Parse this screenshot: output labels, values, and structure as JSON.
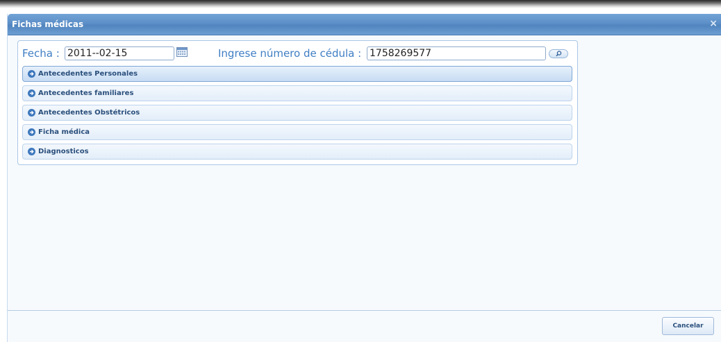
{
  "dialog": {
    "title": "Fichas médicas",
    "close_icon": "close-icon",
    "close_glyph": "×"
  },
  "form": {
    "fecha_label": "Fecha :",
    "fecha_value": "2011--02-15",
    "calendar_icon": "calendar-icon",
    "cedula_label": "Ingrese número de cédula :",
    "cedula_value": "1758269577",
    "search_icon": "search-icon"
  },
  "accordion": {
    "items": [
      {
        "label": "Antecedentes Personales",
        "active": true
      },
      {
        "label": "Antecedentes familiares",
        "active": false
      },
      {
        "label": "Antecedentes Obstétricos",
        "active": false
      },
      {
        "label": "Ficha médica",
        "active": false
      },
      {
        "label": "Diagnosticos",
        "active": false
      }
    ]
  },
  "footer": {
    "cancel_label": "Cancelar"
  },
  "colors": {
    "titlebar": "#5d8fc8",
    "label_blue": "#3f7ec4",
    "accordion_text": "#2a4f7c",
    "icon_blue": "#3d78bd"
  }
}
